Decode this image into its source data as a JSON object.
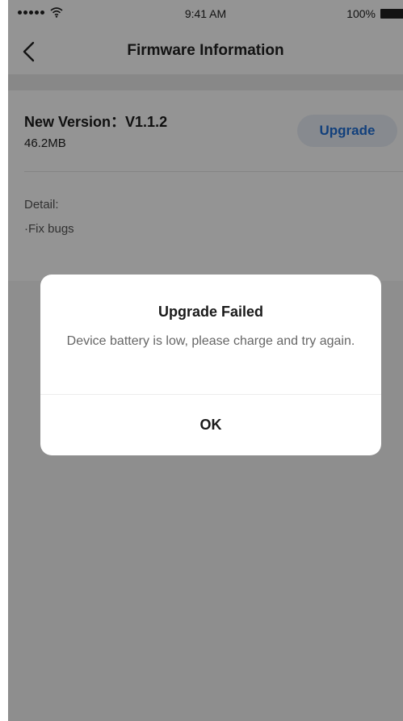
{
  "status_bar": {
    "time": "9:41 AM",
    "battery": "100%",
    "wifi_icon": "wifi-icon",
    "signal_icon": "signal-dots-icon"
  },
  "nav": {
    "title": "Firmware Information",
    "back_icon": "chevron-left-icon"
  },
  "firmware": {
    "version": "New Version：V1.1.2",
    "size": "46.2MB",
    "upgrade_label": "Upgrade",
    "detail_label": "Detail:",
    "detail_items": [
      "·Fix bugs"
    ]
  },
  "dialog": {
    "title": "Upgrade Failed",
    "message": "Device battery is low, please charge and try again.",
    "ok_label": "OK"
  },
  "colors": {
    "accent": "#1f6fd6",
    "overlay": "rgba(0,0,0,0.42)"
  }
}
